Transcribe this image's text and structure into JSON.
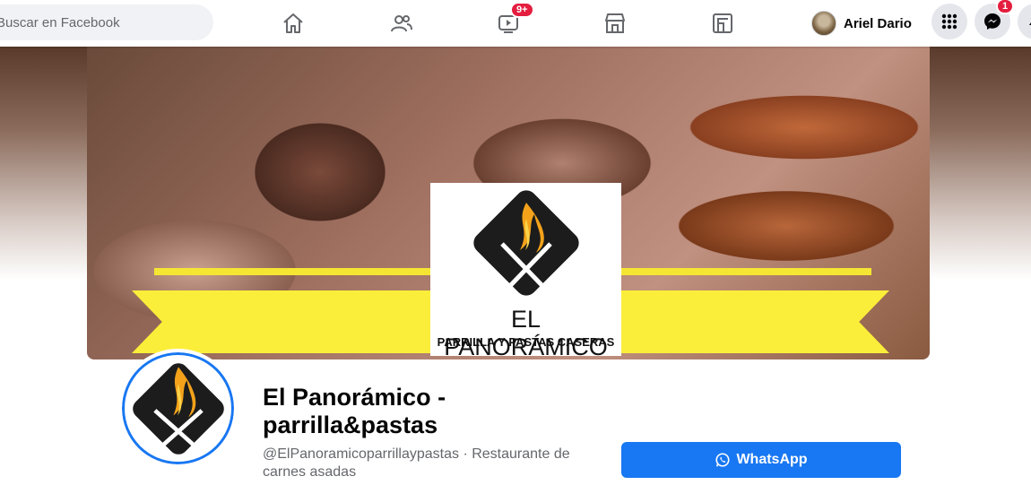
{
  "topbar": {
    "search_placeholder": "Buscar en Facebook",
    "nav": {
      "watch_badge": "9+"
    },
    "profile_name": "Ariel Dario",
    "messenger_badge": "1"
  },
  "cover": {
    "logo_title": "EL PANORÁMICO",
    "logo_subtitle": "PARRILLA Y PASTAS CASERAS",
    "banner_color": "#fbee3a"
  },
  "page": {
    "title": "El Panorámico - parrilla&pastas",
    "subtitle": "@ElPanoramicoparrillaypastas · Restaurante de carnes asadas"
  },
  "actions": {
    "whatsapp_label": "WhatsApp"
  },
  "colors": {
    "accent": "#1877f2",
    "badge": "#e41e3f"
  }
}
